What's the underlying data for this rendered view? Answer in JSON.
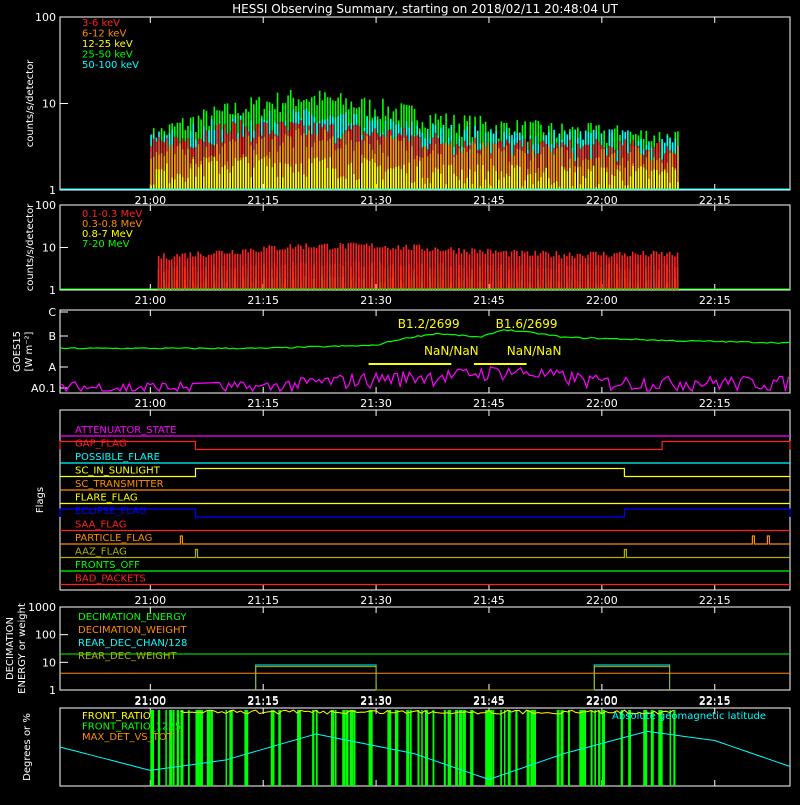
{
  "title": "HESSI Observing Summary, starting on 2018/02/11 20:48:04 UT",
  "colors": {
    "red": "#ff2020",
    "orange": "#ff8c00",
    "yellow": "#ffff00",
    "green": "#00ff00",
    "cyan": "#00ffff",
    "magenta": "#ff00ff",
    "blue": "#0000ff",
    "olive": "#b0b000",
    "white": "#ffffff",
    "axis": "#ffffff"
  },
  "time_ticks": [
    "21:00",
    "21:15",
    "21:30",
    "21:45",
    "22:00",
    "22:15"
  ],
  "chart_data": [
    {
      "type": "line",
      "name": "panel-counts-low",
      "ylabel": "counts/s/detector",
      "yscale": "log",
      "ylim": [
        1,
        100
      ],
      "yticks": [
        "1",
        "10",
        "100"
      ],
      "xlim": [
        "20:48",
        "22:25"
      ],
      "data_interval": [
        "21:00",
        "22:10"
      ],
      "legend": [
        "3-6 keV",
        "6-12 keV",
        "12-25 keV",
        "25-50 keV",
        "50-100 keV"
      ],
      "legend_colors": [
        "red",
        "orange",
        "yellow",
        "green",
        "cyan"
      ],
      "series": [
        {
          "name": "3-6 keV",
          "x": [
            "21:00",
            "21:10",
            "21:20",
            "21:30",
            "21:40",
            "21:50",
            "22:00",
            "22:10"
          ],
          "values": [
            3.0,
            5.0,
            5.0,
            4.5,
            3.5,
            3.0,
            3.0,
            3.0
          ]
        },
        {
          "name": "6-12 keV",
          "x": [
            "21:00",
            "21:10",
            "21:20",
            "21:30",
            "21:40",
            "21:50",
            "22:00",
            "22:10"
          ],
          "values": [
            2.5,
            3.0,
            4.0,
            3.5,
            3.0,
            2.5,
            2.5,
            2.5
          ]
        },
        {
          "name": "12-25 keV",
          "x": [
            "21:00",
            "21:10",
            "21:20",
            "21:30",
            "21:40",
            "21:50",
            "22:00",
            "22:10"
          ],
          "values": [
            1.5,
            2.0,
            2.0,
            1.8,
            1.6,
            1.5,
            1.5,
            1.5
          ]
        },
        {
          "name": "25-50 keV",
          "x": [
            "21:00",
            "21:10",
            "21:20",
            "21:30",
            "21:40",
            "21:50",
            "22:00",
            "22:10"
          ],
          "values": [
            4.0,
            8.0,
            12.0,
            9.0,
            6.0,
            5.0,
            4.5,
            4.0
          ]
        },
        {
          "name": "50-100 keV",
          "x": [
            "21:00",
            "21:10",
            "21:20",
            "21:30",
            "21:40",
            "21:50",
            "22:00",
            "22:10"
          ],
          "values": [
            3.5,
            5.5,
            7.0,
            5.5,
            4.5,
            4.0,
            4.0,
            3.5
          ]
        }
      ]
    },
    {
      "type": "line",
      "name": "panel-counts-high",
      "ylabel": "counts/s/detector",
      "yscale": "log",
      "ylim": [
        1,
        100
      ],
      "yticks": [
        "1",
        "10",
        "100"
      ],
      "xlim": [
        "20:48",
        "22:25"
      ],
      "data_interval": [
        "21:01",
        "22:10"
      ],
      "legend": [
        "0.1-0.3 MeV",
        "0.3-0.8 MeV",
        "0.8-7 MeV",
        "7-20 MeV"
      ],
      "legend_colors": [
        "red",
        "orange",
        "yellow",
        "green"
      ],
      "series": [
        {
          "name": "0.1-0.3 MeV",
          "x": [
            "21:01",
            "21:10",
            "21:20",
            "21:30",
            "21:40",
            "21:50",
            "22:00",
            "22:10"
          ],
          "values": [
            6.0,
            8.0,
            11.0,
            11.0,
            9.0,
            7.0,
            7.0,
            7.0
          ]
        },
        {
          "name": "0.3-0.8 MeV",
          "x": [
            "21:01",
            "21:10",
            "21:20",
            "21:30",
            "21:40",
            "21:50",
            "22:00",
            "22:10"
          ],
          "values": [
            3.0,
            3.5,
            4.0,
            4.0,
            3.5,
            3.5,
            3.5,
            3.5
          ]
        },
        {
          "name": "0.8-7 MeV",
          "x": [
            "21:01",
            "21:10",
            "21:20",
            "21:30",
            "21:40",
            "21:50",
            "22:00",
            "22:10"
          ],
          "values": [
            1.5,
            1.7,
            1.8,
            1.8,
            1.7,
            1.6,
            1.6,
            1.6
          ]
        },
        {
          "name": "7-20 MeV",
          "x": [
            "20:48",
            "22:25"
          ],
          "values": [
            1.0,
            1.0
          ]
        }
      ]
    },
    {
      "type": "line",
      "name": "panel-goes",
      "ylabel": "GOES15",
      "yunit": "[W m-2]",
      "ylabel_lines": [
        "GOES15",
        "[W m⁻²]"
      ],
      "yticks": [
        "A0.1",
        "A",
        "B",
        "C"
      ],
      "xlim": [
        "20:48",
        "22:25"
      ],
      "annotations": [
        "B1.2/2699",
        "B1.6/2699",
        "NaN/NaN",
        "NaN/NaN"
      ],
      "series": [
        {
          "name": "goes-long",
          "color": "green",
          "x": [
            "20:48",
            "21:15",
            "21:30",
            "21:38",
            "21:44",
            "21:47",
            "21:55",
            "22:10",
            "22:25"
          ],
          "values": [
            0.4,
            0.4,
            0.5,
            1.2,
            0.9,
            1.6,
            0.9,
            0.7,
            0.6
          ]
        },
        {
          "name": "goes-short",
          "color": "magenta",
          "x": [
            "20:48",
            "21:15",
            "21:30",
            "21:40",
            "21:47",
            "22:00",
            "22:25"
          ],
          "values": [
            0.02,
            0.02,
            0.04,
            0.05,
            0.07,
            0.03,
            0.03
          ]
        }
      ]
    },
    {
      "type": "table",
      "name": "panel-flags",
      "ylabel": "Flags",
      "flags": [
        {
          "label": "ATTENUATOR_STATE",
          "color": "magenta",
          "on": []
        },
        {
          "label": "GAP_FLAG",
          "color": "red",
          "on": [
            [
              "20:48",
              "21:06"
            ],
            [
              "22:08",
              "22:25"
            ]
          ]
        },
        {
          "label": "POSSIBLE_FLARE",
          "color": "cyan",
          "on": []
        },
        {
          "label": "SC_IN_SUNLIGHT",
          "color": "yellow",
          "on": [
            [
              "21:06",
              "22:03"
            ]
          ]
        },
        {
          "label": "SC_TRANSMITTER",
          "color": "orange",
          "on": []
        },
        {
          "label": "FLARE_FLAG",
          "color": "yellow",
          "on": []
        },
        {
          "label": "ECLIPSE_FLAG",
          "color": "blue",
          "on": [
            [
              "20:48",
              "21:06"
            ],
            [
              "22:03",
              "22:25"
            ]
          ]
        },
        {
          "label": "SAA_FLAG",
          "color": "red",
          "on": []
        },
        {
          "label": "PARTICLE_FLAG",
          "color": "orange",
          "on": [
            [
              "21:04",
              "21:04"
            ],
            [
              "22:20",
              "22:20"
            ],
            [
              "22:22",
              "22:22"
            ]
          ]
        },
        {
          "label": "AAZ_FLAG",
          "color": "olive",
          "on": [
            [
              "21:06",
              "21:06"
            ],
            [
              "22:03",
              "22:03"
            ]
          ]
        },
        {
          "label": "FRONTS_OFF",
          "color": "green",
          "on": []
        },
        {
          "label": "BAD_PACKETS",
          "color": "red",
          "on": []
        }
      ]
    },
    {
      "type": "line",
      "name": "panel-decimation",
      "ylabel_lines": [
        "DECIMATION",
        "ENERGY or weight"
      ],
      "yscale": "log",
      "ylim": [
        1,
        1000
      ],
      "yticks": [
        "1",
        "10",
        "100",
        "1000"
      ],
      "xlim": [
        "20:48",
        "22:25"
      ],
      "legend": [
        "DECIMATION_ENERGY",
        "DECIMATION_WEIGHT",
        "REAR_DEC_CHAN/128",
        "REAR_DEC_WEIGHT"
      ],
      "legend_colors": [
        "green",
        "orange",
        "cyan",
        "olive"
      ],
      "series": [
        {
          "name": "DECIMATION_ENERGY",
          "x": [
            "20:48",
            "22:25"
          ],
          "values": [
            20,
            20
          ]
        },
        {
          "name": "DECIMATION_WEIGHT",
          "x": [
            "20:48",
            "22:25"
          ],
          "values": [
            4,
            4
          ]
        },
        {
          "name": "REAR_DEC_CHAN/128",
          "x": [
            "21:14",
            "21:14",
            "21:30",
            "21:30",
            "21:59",
            "21:59",
            "22:09",
            "22:09"
          ],
          "values": [
            1,
            8,
            8,
            1,
            1,
            8,
            8,
            1
          ]
        },
        {
          "name": "REAR_DEC_WEIGHT",
          "x": [
            "21:14",
            "21:14",
            "21:30",
            "21:30",
            "21:59",
            "21:59",
            "22:09",
            "22:09"
          ],
          "values": [
            1,
            7,
            7,
            1,
            1,
            7,
            7,
            1
          ]
        }
      ]
    },
    {
      "type": "line",
      "name": "panel-ratios",
      "ylabel": "Degrees or %",
      "xlim": [
        "20:48",
        "22:25"
      ],
      "legend": [
        "FRONT_RATIO",
        "FRONT_RATIO_1225",
        "MAX_DET_VS_TOT"
      ],
      "legend_colors": [
        "yellow",
        "green",
        "orange"
      ],
      "right_legend": "Absolute geomagnetic latitude",
      "series": [
        {
          "name": "Absolute geomagnetic latitude",
          "color": "cyan",
          "x": [
            "20:48",
            "21:00",
            "21:10",
            "21:22",
            "21:35",
            "21:45",
            "21:55",
            "22:06",
            "22:15",
            "22:25"
          ],
          "values": [
            30,
            12,
            20,
            40,
            25,
            5,
            25,
            42,
            35,
            15
          ]
        }
      ]
    }
  ]
}
